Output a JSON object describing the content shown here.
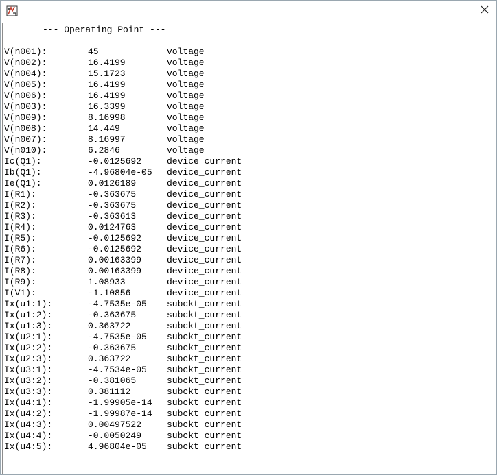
{
  "window": {
    "app_icon": "ltspice-icon",
    "close_icon": "close-icon"
  },
  "output": {
    "header": "--- Operating Point ---",
    "rows": [
      {
        "name": "V(n001):",
        "value": "45",
        "type": "voltage"
      },
      {
        "name": "V(n002):",
        "value": "16.4199",
        "type": "voltage"
      },
      {
        "name": "V(n004):",
        "value": "15.1723",
        "type": "voltage"
      },
      {
        "name": "V(n005):",
        "value": "16.4199",
        "type": "voltage"
      },
      {
        "name": "V(n006):",
        "value": "16.4199",
        "type": "voltage"
      },
      {
        "name": "V(n003):",
        "value": "16.3399",
        "type": "voltage"
      },
      {
        "name": "V(n009):",
        "value": "8.16998",
        "type": "voltage"
      },
      {
        "name": "V(n008):",
        "value": "14.449",
        "type": "voltage"
      },
      {
        "name": "V(n007):",
        "value": "8.16997",
        "type": "voltage"
      },
      {
        "name": "V(n010):",
        "value": "6.2846",
        "type": "voltage"
      },
      {
        "name": "Ic(Q1):",
        "value": "-0.0125692",
        "type": "device_current"
      },
      {
        "name": "Ib(Q1):",
        "value": "-4.96804e-05",
        "type": "device_current"
      },
      {
        "name": "Ie(Q1):",
        "value": "0.0126189",
        "type": "device_current"
      },
      {
        "name": "I(R1):",
        "value": "-0.363675",
        "type": "device_current"
      },
      {
        "name": "I(R2):",
        "value": "-0.363675",
        "type": "device_current"
      },
      {
        "name": "I(R3):",
        "value": "-0.363613",
        "type": "device_current"
      },
      {
        "name": "I(R4):",
        "value": "0.0124763",
        "type": "device_current"
      },
      {
        "name": "I(R5):",
        "value": "-0.0125692",
        "type": "device_current"
      },
      {
        "name": "I(R6):",
        "value": "-0.0125692",
        "type": "device_current"
      },
      {
        "name": "I(R7):",
        "value": "0.00163399",
        "type": "device_current"
      },
      {
        "name": "I(R8):",
        "value": "0.00163399",
        "type": "device_current"
      },
      {
        "name": "I(R9):",
        "value": "1.08933",
        "type": "device_current"
      },
      {
        "name": "I(V1):",
        "value": "-1.10856",
        "type": "device_current"
      },
      {
        "name": "Ix(u1:1):",
        "value": "-4.7535e-05",
        "type": "subckt_current"
      },
      {
        "name": "Ix(u1:2):",
        "value": "-0.363675",
        "type": "subckt_current"
      },
      {
        "name": "Ix(u1:3):",
        "value": "0.363722",
        "type": "subckt_current"
      },
      {
        "name": "Ix(u2:1):",
        "value": "-4.7535e-05",
        "type": "subckt_current"
      },
      {
        "name": "Ix(u2:2):",
        "value": "-0.363675",
        "type": "subckt_current"
      },
      {
        "name": "Ix(u2:3):",
        "value": "0.363722",
        "type": "subckt_current"
      },
      {
        "name": "Ix(u3:1):",
        "value": "-4.7534e-05",
        "type": "subckt_current"
      },
      {
        "name": "Ix(u3:2):",
        "value": "-0.381065",
        "type": "subckt_current"
      },
      {
        "name": "Ix(u3:3):",
        "value": "0.381112",
        "type": "subckt_current"
      },
      {
        "name": "Ix(u4:1):",
        "value": "-1.99905e-14",
        "type": "subckt_current"
      },
      {
        "name": "Ix(u4:2):",
        "value": "-1.99987e-14",
        "type": "subckt_current"
      },
      {
        "name": "Ix(u4:3):",
        "value": "0.00497522",
        "type": "subckt_current"
      },
      {
        "name": "Ix(u4:4):",
        "value": "-0.0050249",
        "type": "subckt_current"
      },
      {
        "name": "Ix(u4:5):",
        "value": "4.96804e-05",
        "type": "subckt_current"
      }
    ]
  }
}
